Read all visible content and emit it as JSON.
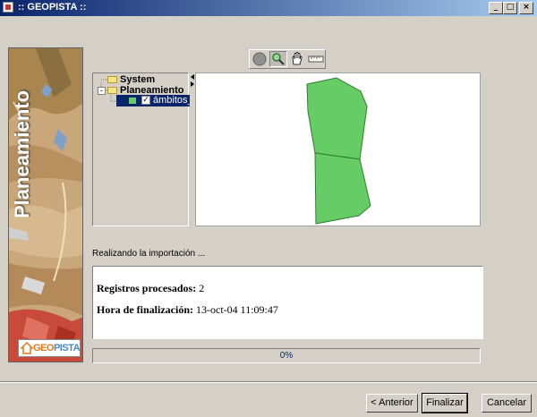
{
  "window": {
    "title": ":: GEOPISTA ::",
    "controls": [
      "minimize",
      "maximize",
      "close"
    ]
  },
  "sidebar": {
    "title": "Planeamiento",
    "logo_text_a": "GEO",
    "logo_text_b": "PISTA"
  },
  "toolbar": {
    "tools": [
      "zoom-extent",
      "zoom-in",
      "pan",
      "measure"
    ],
    "selected": "zoom-in"
  },
  "layer_tree": {
    "groups": [
      {
        "label": "System",
        "expanded": false
      },
      {
        "label": "Planeamiento",
        "expanded": true
      }
    ],
    "layer": {
      "label": "ámbitos_ge",
      "visible": true,
      "color": "#66cc66"
    }
  },
  "map": {
    "fill_color": "#66cc66",
    "stroke_color": "#2e7d2e"
  },
  "status_text": "Realizando la importación ...",
  "results": {
    "registros_label": "Registros procesados:",
    "registros_value": "2",
    "hora_label": "Hora de finalización:",
    "hora_value": "13-oct-04 11:09:47"
  },
  "progress": {
    "value": 0,
    "label": "0%"
  },
  "buttons": {
    "anterior": "< Anterior",
    "finalizar": "Finalizar",
    "cancelar": "Cancelar"
  }
}
